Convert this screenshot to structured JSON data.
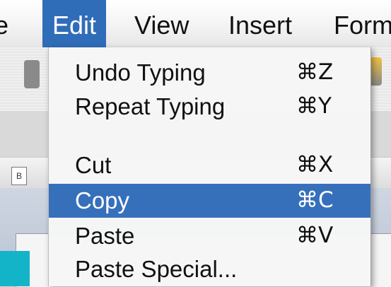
{
  "menubar": {
    "items": [
      {
        "label": "e"
      },
      {
        "label": "Edit"
      },
      {
        "label": "View"
      },
      {
        "label": "Insert"
      },
      {
        "label": "Form"
      }
    ],
    "active": "Edit"
  },
  "edit_menu": {
    "items": [
      {
        "label": "Undo Typing",
        "shortcut": "⌘Z"
      },
      {
        "label": "Repeat Typing",
        "shortcut": "⌘Y"
      },
      {
        "label": "Cut",
        "shortcut": "⌘X"
      },
      {
        "label": "Copy",
        "shortcut": "⌘C",
        "selected": true
      },
      {
        "label": "Paste",
        "shortcut": "⌘V"
      },
      {
        "label": "Paste Special..."
      }
    ]
  },
  "ruler": {
    "box_label": "B"
  },
  "colors": {
    "selection": "#3670bb",
    "menu_bg": "#f6f6f6",
    "accent_tab": "#14b4c8"
  }
}
